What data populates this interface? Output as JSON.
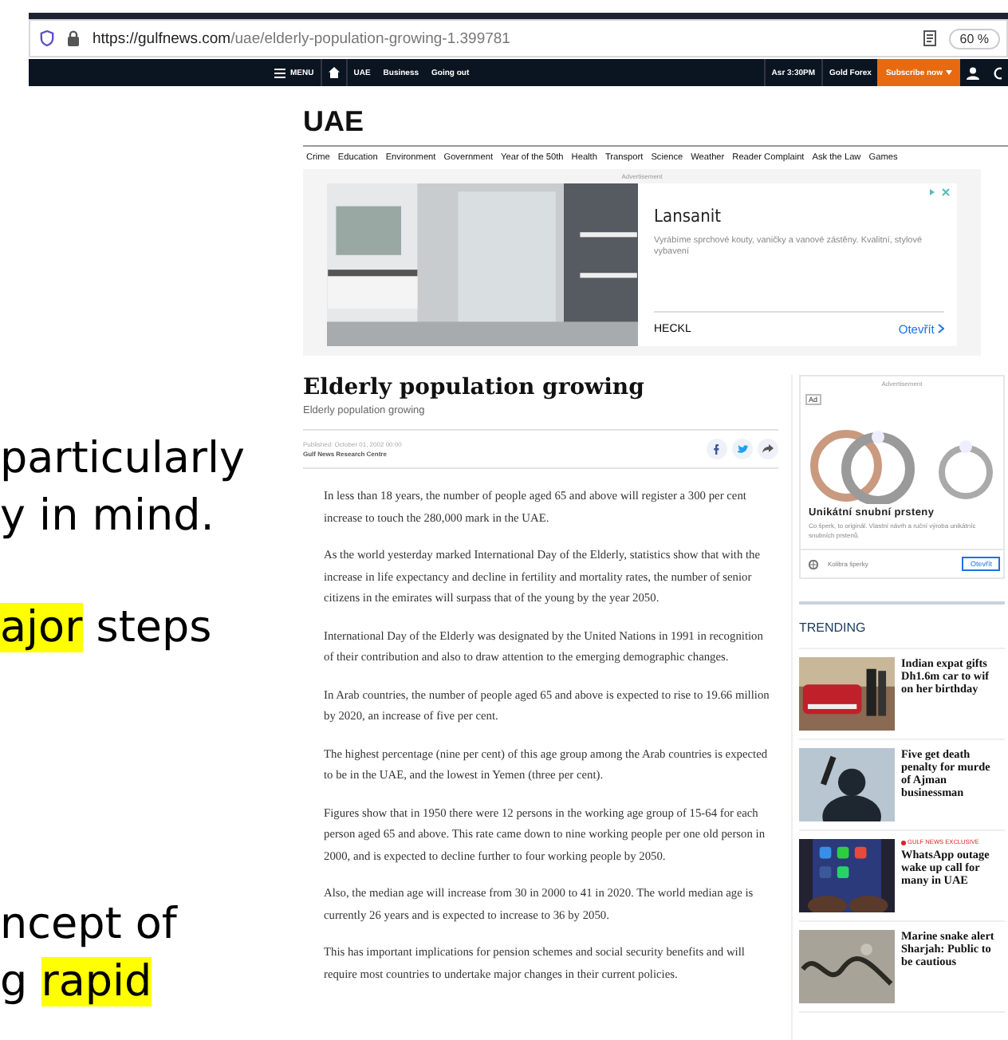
{
  "browser": {
    "url_host": "https://gulfnews.com",
    "url_path": "/uae/elderly-population-growing-1.399781",
    "zoom": "60 %"
  },
  "site_nav": {
    "menu": "MENU",
    "left_links": [
      "UAE",
      "Business",
      "Going out"
    ],
    "right_links": [
      "Asr 3:30PM",
      "Gold Forex"
    ],
    "subscribe": "Subscribe now"
  },
  "slide_blocks": [
    [
      {
        "parts": [
          {
            "text": "particularly",
            "highlighted": false
          }
        ]
      },
      {
        "parts": [
          {
            "text": "y in mind.",
            "highlighted": false
          }
        ]
      }
    ],
    [
      {
        "parts": [
          {
            "text": "ajor",
            "highlighted": true
          },
          {
            "text": " steps",
            "highlighted": false
          }
        ]
      }
    ],
    [
      {
        "parts": [
          {
            "text": "ncept of",
            "highlighted": false
          }
        ]
      },
      {
        "parts": [
          {
            "text": "g ",
            "highlighted": false
          },
          {
            "text": "rapid",
            "highlighted": true
          }
        ]
      }
    ]
  ],
  "section": {
    "title": "UAE",
    "categories": [
      "Crime",
      "Education",
      "Environment",
      "Government",
      "Year of the 50th",
      "Health",
      "Transport",
      "Science",
      "Weather",
      "Reader Complaint",
      "Ask the Law",
      "Games"
    ]
  },
  "top_ad": {
    "label": "Advertisement",
    "title": "Lansanit",
    "text": "Vyrábíme sprchové kouty, vaničky a vanové zástěny. Kvalitní, stylové vybavení",
    "brand": "HECKL",
    "cta": "Otevřít"
  },
  "article": {
    "title": "Elderly population growing",
    "subtitle": "Elderly population growing",
    "published": "Published: October 01, 2002 00:00",
    "author": "Gulf News Research Centre",
    "paragraphs": [
      "In less than 18 years, the number of people aged 65 and above will register a 300 per cent increase to touch the 280,000 mark in the UAE.",
      "As the world yesterday marked International Day of the Elderly, statistics show that with the increase in life expectancy and decline in fertility and mortality rates, the number of senior citizens in the emirates will surpass that of the young by the year 2050.",
      "International Day of the Elderly was designated by the United Nations in 1991 in recognition of their contribution and also to draw attention to the emerging demographic changes.",
      "In Arab countries, the number of people aged 65 and above is expected to rise to 19.66 million by 2020, an increase of five per cent.",
      "The highest percentage (nine per cent) of this age group among the Arab countries is expected to be in the UAE, and the lowest in Yemen (three per cent).",
      "Figures show that in 1950 there were 12 persons in the working age group of 15-64 for each person aged 65 and above. This rate came down to nine working people per one old person in 2000, and is expected to decline further to four working people by 2050.",
      "Also, the median age will increase from 30 in 2000 to 41 in 2020. The world median age is currently 26 years and is expected to increase to 36 by 2050.",
      "This has important implications for pension schemes and social security benefits and will require most countries to undertake major changes in their current policies."
    ]
  },
  "side_ad": {
    "label": "Advertisement",
    "badge": "Ad",
    "title": "Unikátní snubní prsteny",
    "text_lines": [
      "Co šperk, to originál. Vlastní návrh a ruční výroba unikátníc",
      "snubních prstenů."
    ],
    "advertiser": "Kolibra šperky",
    "cta": "Otevřít"
  },
  "trending": {
    "title": "TRENDING",
    "items": [
      {
        "kind": "car",
        "lines": [
          "Indian expat gifts",
          "Dh1.6m car to wif",
          "on her birthday"
        ]
      },
      {
        "kind": "shadow",
        "lines": [
          "Five get death",
          "penalty for murde",
          "of Ajman",
          "businessman"
        ]
      },
      {
        "kind": "phone",
        "tag": "GULF NEWS EXCLUSIVE",
        "lines": [
          "WhatsApp outage",
          "wake up call for",
          "many in UAE"
        ]
      },
      {
        "kind": "snake",
        "lines": [
          "Marine snake alert",
          "Sharjah: Public to",
          "be cautious"
        ]
      }
    ]
  }
}
